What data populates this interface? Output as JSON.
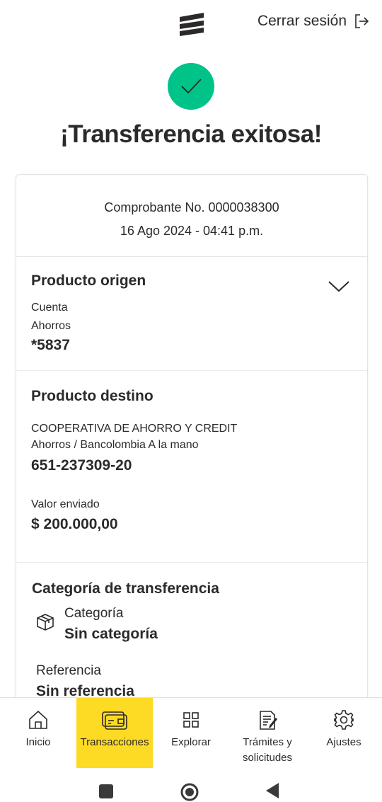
{
  "header": {
    "logo_icon": "bancolombia-logo-icon",
    "logout_label": "Cerrar sesión",
    "logout_icon": "logout-arrow-icon"
  },
  "status": {
    "icon": "check-circle-icon",
    "color": "#00c389",
    "title": "¡Transferencia exitosa!"
  },
  "receipt": {
    "number_line": "Comprobante No. 0000038300",
    "datetime": "16 Ago 2024 - 04:41 p.m."
  },
  "origin": {
    "title": "Producto origen",
    "type_line1": "Cuenta",
    "type_line2": "Ahorros",
    "account": "*5837",
    "expand_icon": "chevron-down-icon"
  },
  "destination": {
    "title": "Producto destino",
    "entity": "COOPERATIVA DE AHORRO Y CREDIT",
    "product": "Ahorros / Bancolombia A la mano",
    "account": "651-237309-20",
    "amount_label": "Valor enviado",
    "amount": "$ 200.000,00"
  },
  "category": {
    "title": "Categoría de transferencia",
    "icon": "box-icon",
    "label": "Categoría",
    "value": "Sin categoría",
    "reference_label": "Referencia",
    "reference_value": "Sin referencia"
  },
  "bottom_nav": {
    "active_color": "#fdda24",
    "items": [
      {
        "label": "Inicio",
        "icon": "home-icon"
      },
      {
        "label": "Transacciones",
        "icon": "card-transfer-icon"
      },
      {
        "label": "Explorar",
        "icon": "grid-icon"
      },
      {
        "label": "Trámites y solicitudes",
        "icon": "document-edit-icon"
      },
      {
        "label": "Ajustes",
        "icon": "gear-icon"
      }
    ]
  },
  "system_nav": {
    "icons": [
      "recents-square-icon",
      "home-circle-icon",
      "back-triangle-icon"
    ]
  }
}
